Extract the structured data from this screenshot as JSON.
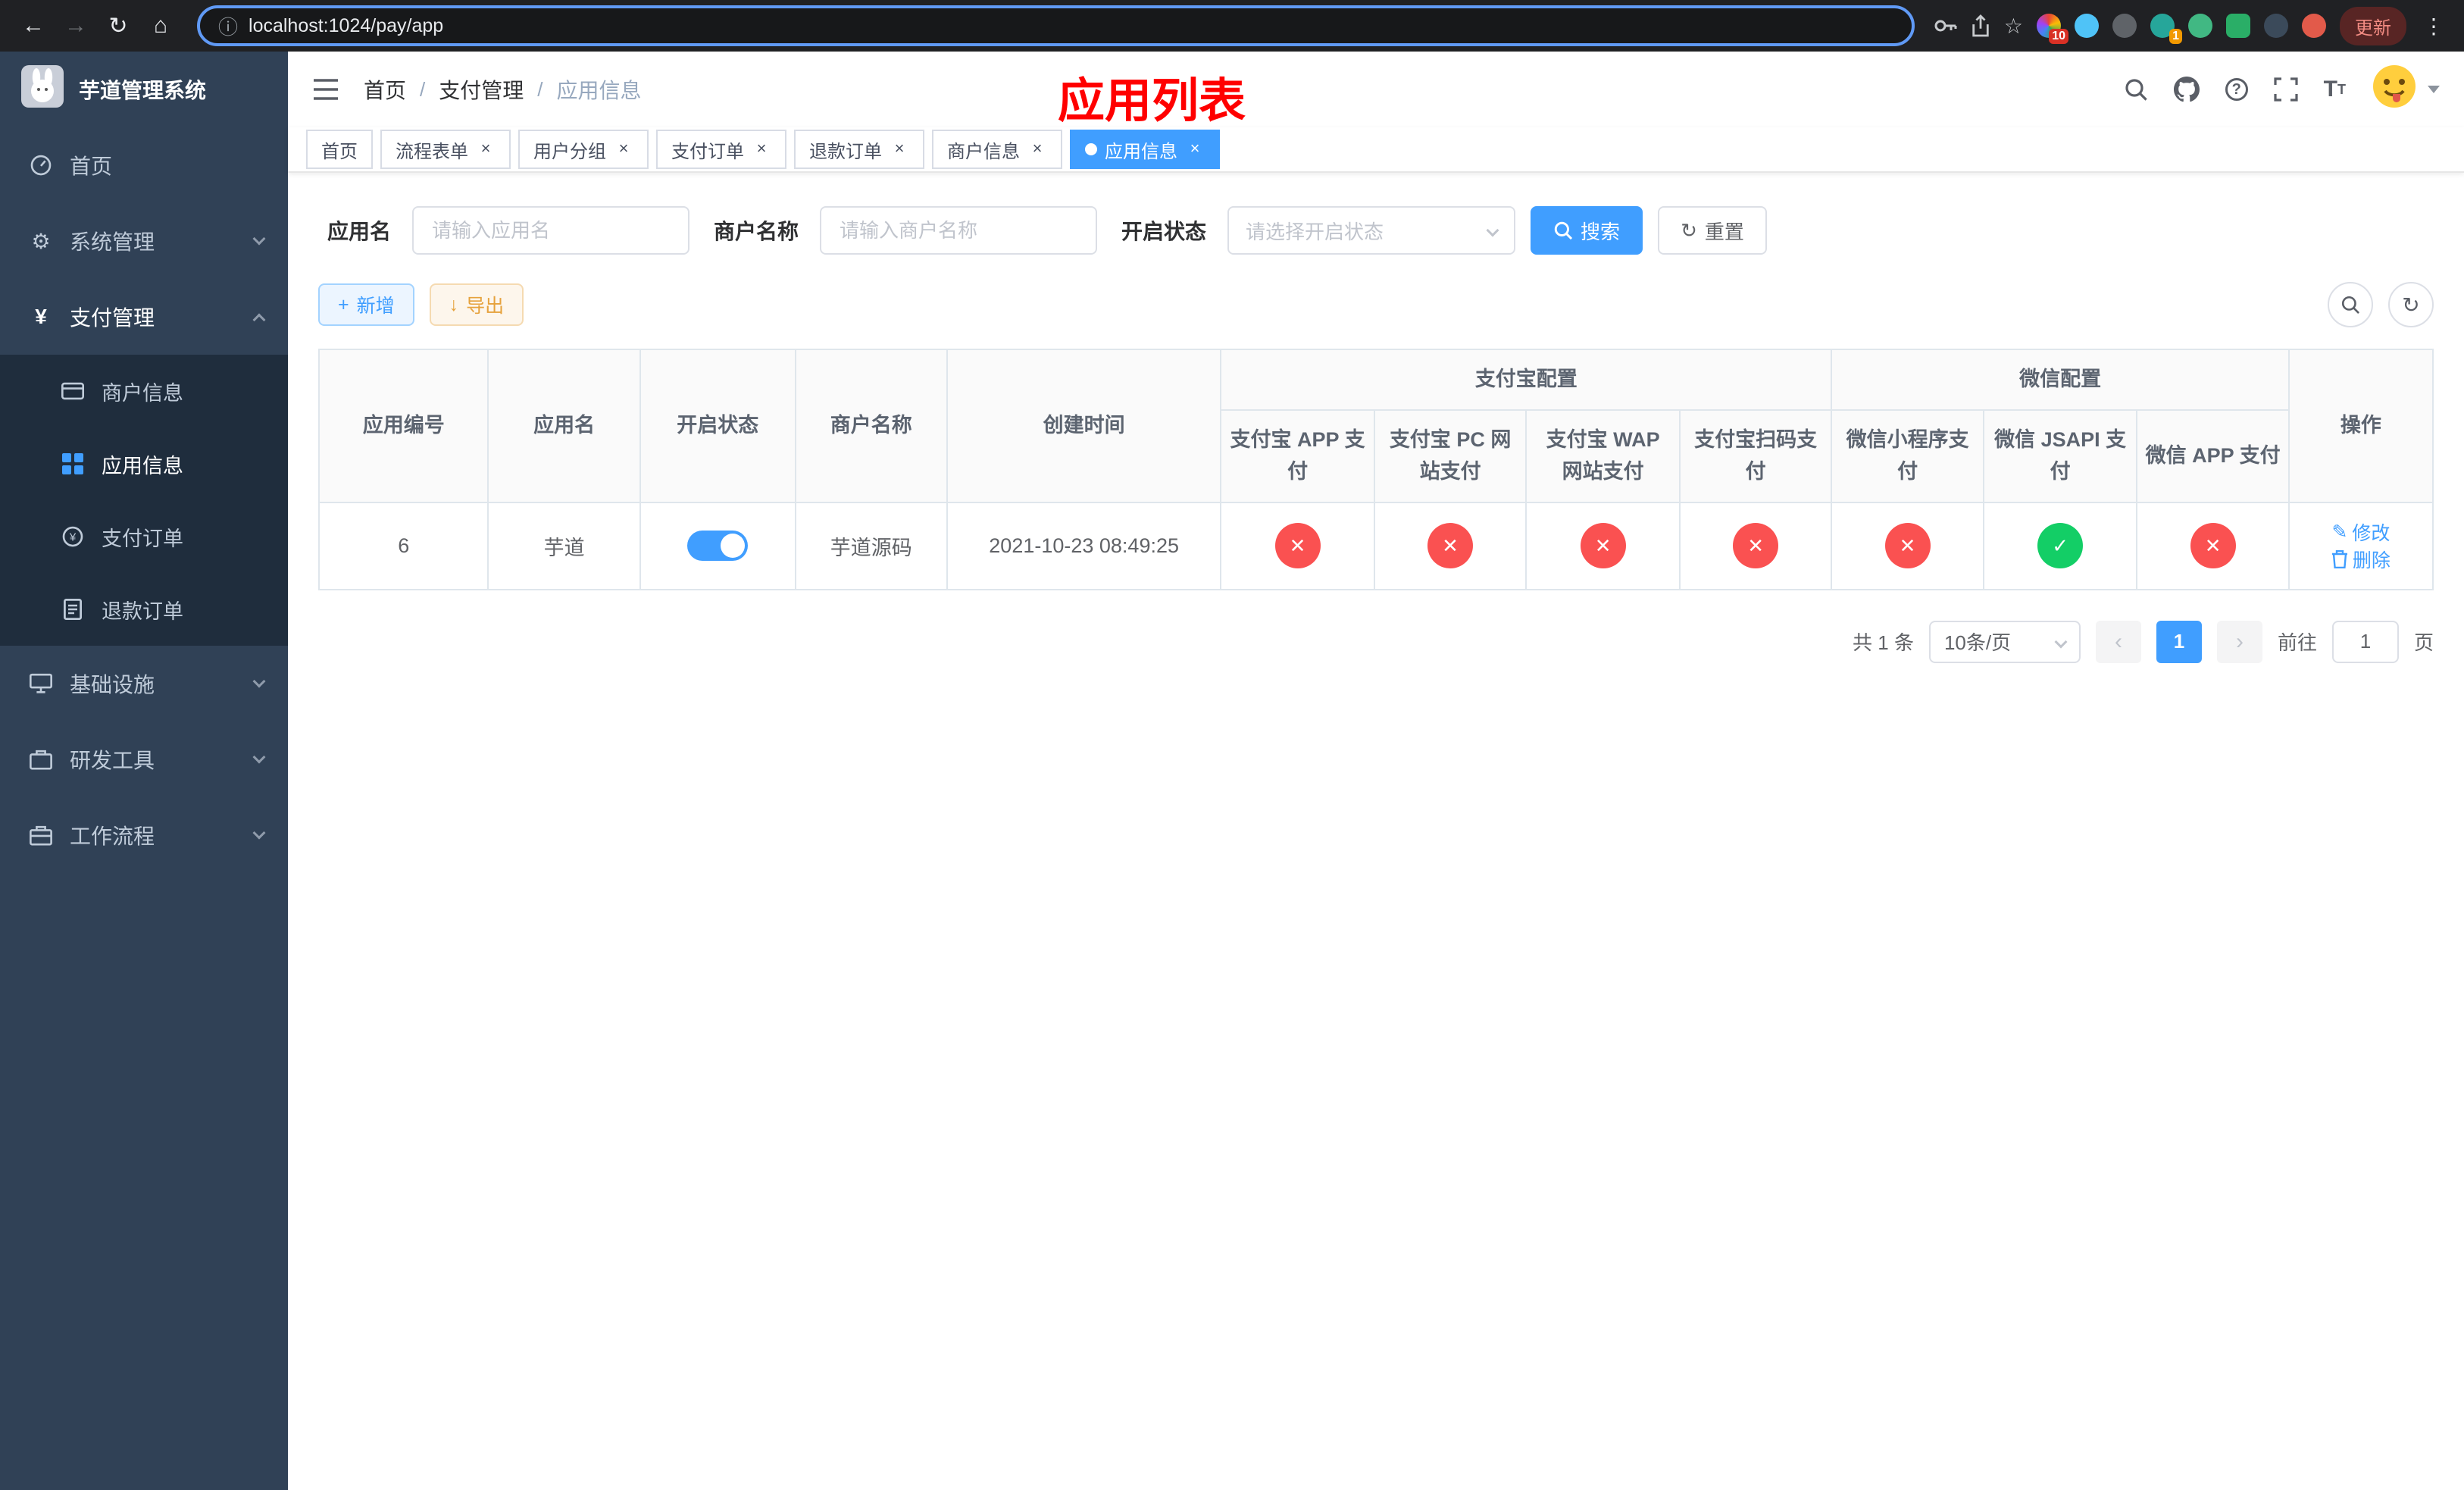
{
  "browser": {
    "url": "localhost:1024/pay/app",
    "update_label": "更新",
    "ext_badges": {
      "grid": "10",
      "user": "1"
    }
  },
  "app": {
    "logo_title": "芋道管理系统",
    "annotation": "应用列表"
  },
  "sidebar": {
    "items": [
      {
        "label": "首页"
      },
      {
        "label": "系统管理"
      },
      {
        "label": "支付管理"
      },
      {
        "label": "基础设施"
      },
      {
        "label": "研发工具"
      },
      {
        "label": "工作流程"
      }
    ],
    "pay_children": [
      {
        "label": "商户信息"
      },
      {
        "label": "应用信息"
      },
      {
        "label": "支付订单"
      },
      {
        "label": "退款订单"
      }
    ]
  },
  "breadcrumb": {
    "items": [
      "首页",
      "支付管理",
      "应用信息"
    ],
    "separator": "/"
  },
  "tabs": [
    {
      "label": "首页"
    },
    {
      "label": "流程表单"
    },
    {
      "label": "用户分组"
    },
    {
      "label": "支付订单"
    },
    {
      "label": "退款订单"
    },
    {
      "label": "商户信息"
    },
    {
      "label": "应用信息"
    }
  ],
  "filters": {
    "app_name_label": "应用名",
    "app_name_placeholder": "请输入应用名",
    "merchant_label": "商户名称",
    "merchant_placeholder": "请输入商户名称",
    "status_label": "开启状态",
    "status_placeholder": "请选择开启状态",
    "search_label": "搜索",
    "reset_label": "重置"
  },
  "toolbar": {
    "add_label": "新增",
    "export_label": "导出"
  },
  "table": {
    "group_alipay": "支付宝配置",
    "group_wechat": "微信配置",
    "columns": [
      "应用编号",
      "应用名",
      "开启状态",
      "商户名称",
      "创建时间",
      "支付宝 APP 支付",
      "支付宝 PC 网站支付",
      "支付宝 WAP 网站支付",
      "支付宝扫码支付",
      "微信小程序支付",
      "微信 JSAPI 支付",
      "微信 APP 支付",
      "操作"
    ],
    "row": {
      "id": "6",
      "name": "芋道",
      "enabled": true,
      "merchant": "芋道源码",
      "created": "2021-10-23 08:49:25",
      "statuses": [
        false,
        false,
        false,
        false,
        false,
        true,
        false
      ],
      "edit_label": "修改",
      "delete_label": "删除"
    }
  },
  "pagination": {
    "total": "共 1 条",
    "page_size": "10条/页",
    "current_page": "1",
    "goto_label": "前往",
    "goto_value": "1",
    "goto_suffix": "页"
  },
  "icons": {
    "back": "←",
    "forward": "→",
    "reload": "↻",
    "home": "⌂",
    "info": "ⓘ",
    "star": "☆",
    "menu_dots": "⋮",
    "close": "×",
    "plus": "+",
    "download": "↓",
    "refresh": "↻",
    "check": "✓",
    "cross": "✕",
    "pencil": "✎",
    "prev": "‹",
    "next": "›"
  },
  "colors": {
    "primary": "#409eff",
    "success": "#13ce66",
    "danger": "#fa5151",
    "sidebar_bg": "#304156",
    "submenu_bg": "#1f2d3d"
  }
}
